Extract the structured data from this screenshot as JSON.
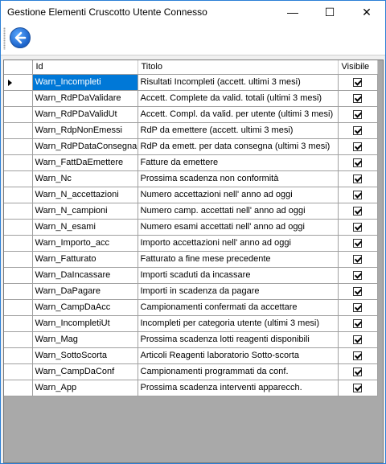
{
  "window": {
    "title": "Gestione Elementi Cruscotto Utente Connesso",
    "minimize_glyph": "—",
    "maximize_glyph": "☐",
    "close_glyph": "✕"
  },
  "toolbar": {
    "back_icon": "back-arrow-icon"
  },
  "colors": {
    "selection": "#0078d7",
    "border": "#2b7fd6",
    "grid_empty": "#a9a9a9"
  },
  "grid": {
    "columns": [
      "Id",
      "Titolo",
      "Visibile"
    ],
    "rows": [
      {
        "id": "Warn_Incompleti",
        "titolo": "Risultati Incompleti (accett. ultimi 3 mesi)",
        "visibile": true,
        "selected": true
      },
      {
        "id": "Warn_RdPDaValidare",
        "titolo": "Accett. Complete da valid. totali (ultimi 3 mesi)",
        "visibile": true
      },
      {
        "id": "Warn_RdPDaValidUt",
        "titolo": "Accett. Compl. da valid. per utente (ultimi 3 mesi)",
        "visibile": true
      },
      {
        "id": "Warn_RdpNonEmessi",
        "titolo": "RdP da emettere (accett. ultimi 3 mesi)",
        "visibile": true
      },
      {
        "id": "Warn_RdPDataConsegna",
        "titolo": "RdP da emett. per data consegna (ultimi 3 mesi)",
        "visibile": true
      },
      {
        "id": "Warn_FattDaEmettere",
        "titolo": "Fatture da emettere",
        "visibile": true
      },
      {
        "id": "Warn_Nc",
        "titolo": "Prossima scadenza non conformità",
        "visibile": true
      },
      {
        "id": "Warn_N_accettazioni",
        "titolo": "Numero accettazioni nell' anno ad oggi",
        "visibile": true
      },
      {
        "id": "Warn_N_campioni",
        "titolo": "Numero camp. accettati nell' anno ad oggi",
        "visibile": true
      },
      {
        "id": "Warn_N_esami",
        "titolo": "Numero esami accettati nell' anno ad oggi",
        "visibile": true
      },
      {
        "id": "Warn_Importo_acc",
        "titolo": "Importo accettazioni nell' anno ad oggi",
        "visibile": true
      },
      {
        "id": "Warn_Fatturato",
        "titolo": "Fatturato a fine mese precedente",
        "visibile": true
      },
      {
        "id": "Warn_DaIncassare",
        "titolo": "Importi scaduti da incassare",
        "visibile": true
      },
      {
        "id": "Warn_DaPagare",
        "titolo": "Importi in scadenza da pagare",
        "visibile": true
      },
      {
        "id": "Warn_CampDaAcc",
        "titolo": "Campionamenti confermati da accettare",
        "visibile": true
      },
      {
        "id": "Warn_IncompletiUt",
        "titolo": "Incompleti per categoria utente (ultimi 3 mesi)",
        "visibile": true
      },
      {
        "id": "Warn_Mag",
        "titolo": "Prossima scadenza lotti reagenti disponibili",
        "visibile": true
      },
      {
        "id": "Warn_SottoScorta",
        "titolo": "Articoli Reagenti laboratorio Sotto-scorta",
        "visibile": true
      },
      {
        "id": "Warn_CampDaConf",
        "titolo": "Campionamenti programmati da conf.",
        "visibile": true
      },
      {
        "id": "Warn_App",
        "titolo": "Prossima scadenza interventi apparecch.",
        "visibile": true
      }
    ]
  }
}
